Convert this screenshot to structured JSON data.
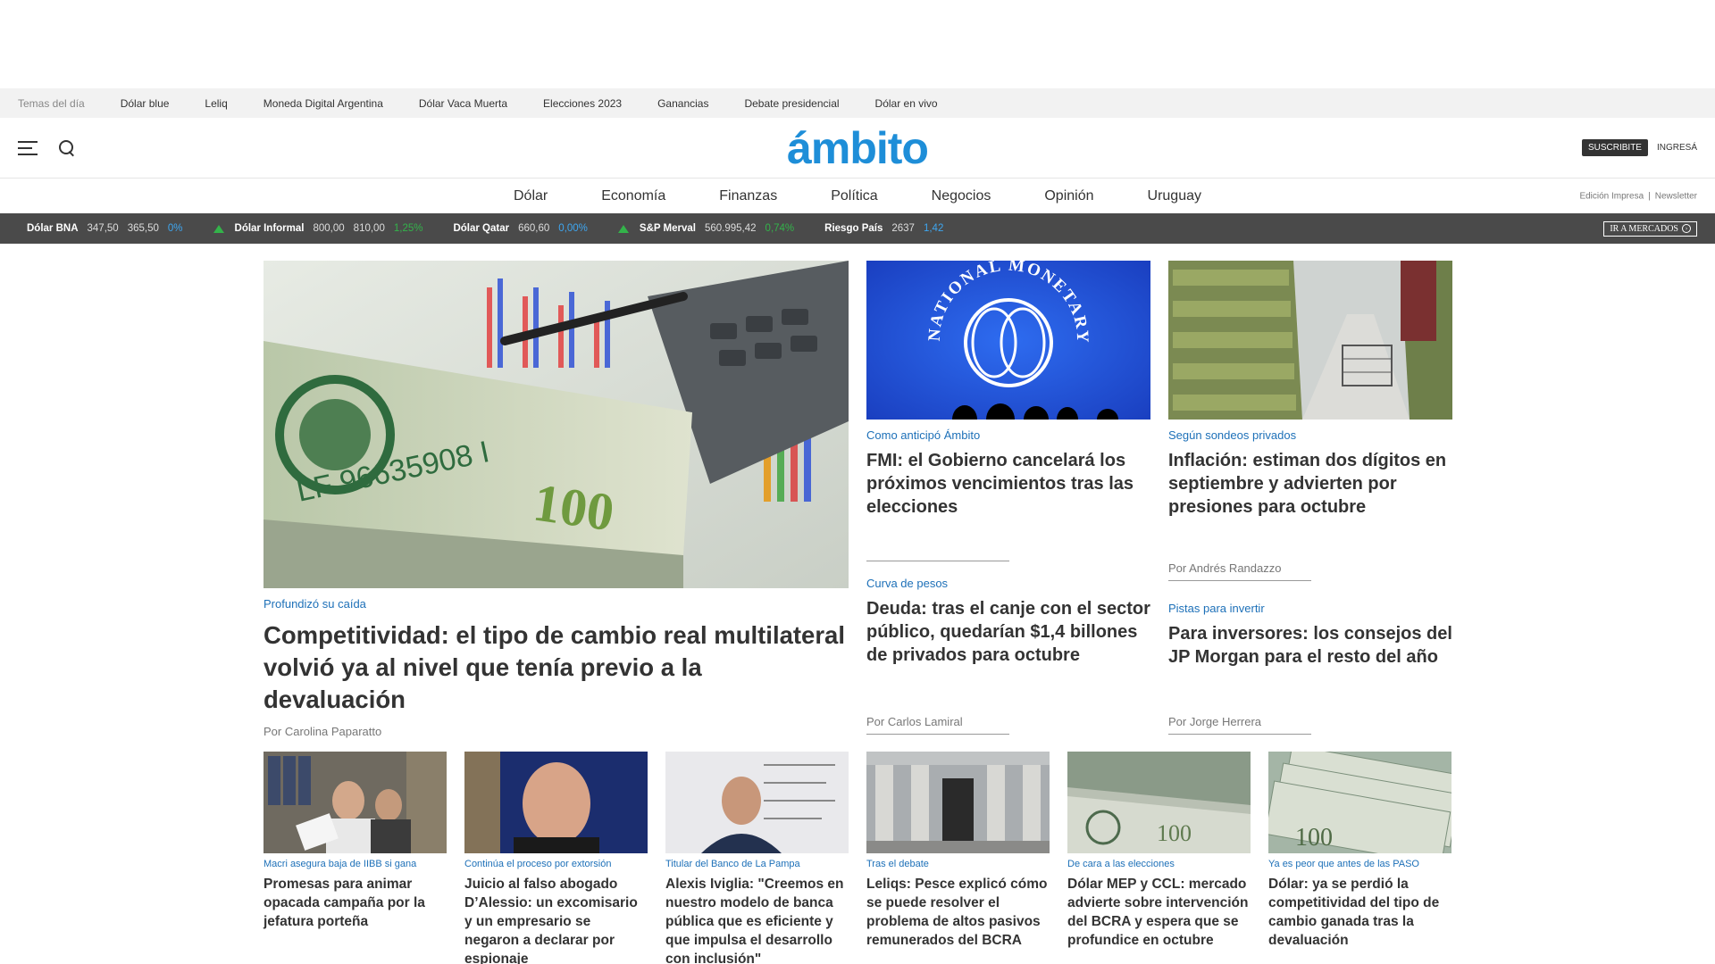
{
  "topics": {
    "label": "Temas del día",
    "items": [
      "Dólar blue",
      "Leliq",
      "Moneda Digital Argentina",
      "Dólar Vaca Muerta",
      "Elecciones 2023",
      "Ganancias",
      "Debate presidencial",
      "Dólar en vivo"
    ]
  },
  "header": {
    "logo": "ámbito",
    "subscribe_label": "SUSCRIBITE",
    "login_label": "INGRESÁ"
  },
  "nav": {
    "items": [
      "Dólar",
      "Economía",
      "Finanzas",
      "Política",
      "Negocios",
      "Opinión",
      "Uruguay"
    ],
    "print_edition": "Edición Impresa",
    "newsletter": "Newsletter"
  },
  "ticker": {
    "items": [
      {
        "name": "Dólar BNA",
        "v1": "347,50",
        "v2": "365,50",
        "chg": "0%"
      },
      {
        "name": "Dólar Informal",
        "v1": "800,00",
        "v2": "810,00",
        "chg": "1,25%"
      },
      {
        "name": "Dólar Qatar",
        "v1": "660,60",
        "v2": "",
        "chg": "0,00%"
      },
      {
        "name": "S&P Merval",
        "v1": "560.995,42",
        "v2": "",
        "chg": "0,74%"
      },
      {
        "name": "Riesgo País",
        "v1": "2637",
        "v2": "",
        "chg": "1,42"
      }
    ],
    "markets_label": "IR A MERCADOS"
  },
  "lead": {
    "kicker": "Profundizó su caída",
    "headline": "Competitividad: el tipo de cambio real multilateral volvió ya al nivel que tenía previo a la devaluación",
    "byline": "Por Carolina Paparatto"
  },
  "col2": {
    "a1": {
      "kicker": "Como anticipó Ámbito",
      "headline": "FMI: el Gobierno cancelará los próximos vencimientos tras las elecciones"
    },
    "a2": {
      "kicker": "Curva de pesos",
      "headline": "Deuda: tras el canje con el sector público, quedarían $1,4 billones de privados para octubre",
      "byline": "Por Carlos Lamiral"
    }
  },
  "col3": {
    "a1": {
      "kicker": "Según sondeos privados",
      "headline": "Inflación: estiman dos dígitos en septiembre y advierten por presiones para octubre",
      "byline": "Por Andrés Randazzo"
    },
    "a2": {
      "kicker": "Pistas para invertir",
      "headline": "Para inversores: los consejos del JP Morgan para el resto del año",
      "byline": "Por Jorge Herrera"
    }
  },
  "small": [
    {
      "kicker": "Macri asegura baja de IIBB si gana",
      "headline": "Promesas para animar opacada campaña por la jefatura porteña"
    },
    {
      "kicker": "Continúa el proceso por extorsión",
      "headline": "Juicio al falso abogado D’Alessio: un excomisario y un empresario se negaron a declarar por espionaje"
    },
    {
      "kicker": "Titular del Banco de La Pampa",
      "headline": "Alexis Iviglia: \"Creemos en nuestro modelo de banca pública que es eficiente y que impulsa el desarrollo con inclusión\""
    },
    {
      "kicker": "Tras el debate",
      "headline": "Leliqs: Pesce explicó cómo se puede resolver el problema de altos pasivos remunerados del BCRA"
    },
    {
      "kicker": "De cara a las elecciones",
      "headline": "Dólar MEP y CCL: mercado advierte sobre intervención del BCRA y espera que se profundice en octubre"
    },
    {
      "kicker": "Ya es peor que antes de las PASO",
      "headline": "Dólar: ya se perdió la competitividad del tipo de cambio ganada tras la devaluación"
    }
  ],
  "image_text": {
    "imf_seal": "INTERNATIONAL MONETARY FUND",
    "banknote": "LF 96635908 I"
  },
  "colors": {
    "brand": "#1e8ed8",
    "kicker": "#1d70b8",
    "ticker_bg": "#4a4a4a",
    "up": "#33b34a"
  }
}
